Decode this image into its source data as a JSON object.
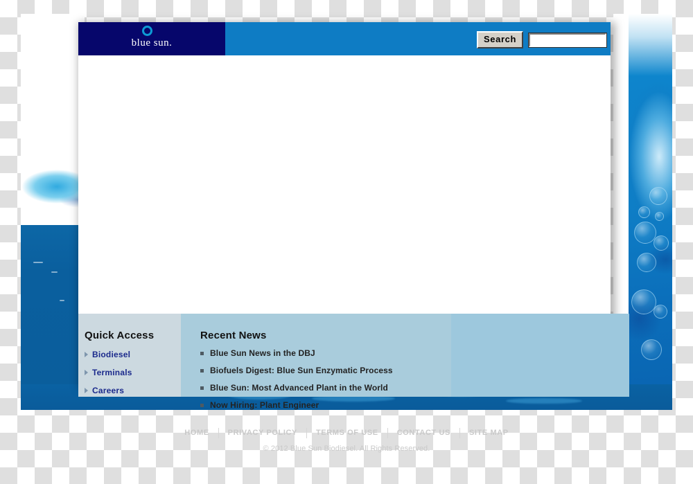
{
  "site": {
    "logo_text": "blue sun.",
    "logo_mark": "sun-ring-icon"
  },
  "search": {
    "button_label": "Search",
    "value": "",
    "placeholder": ""
  },
  "quick_access": {
    "title": "Quick Access",
    "items": [
      {
        "label": "Biodiesel"
      },
      {
        "label": "Terminals"
      },
      {
        "label": "Careers"
      }
    ]
  },
  "recent_news": {
    "title": "Recent News",
    "items": [
      {
        "label": "Blue Sun News in the DBJ"
      },
      {
        "label": "Biofuels Digest: Blue Sun Enzymatic Process"
      },
      {
        "label": "Blue Sun: Most Advanced Plant in the World"
      },
      {
        "label": "Now Hiring: Plant Engineer"
      }
    ]
  },
  "footer": {
    "links": [
      {
        "label": "HOME"
      },
      {
        "label": "PRIVACY POLICY"
      },
      {
        "label": "TERMS OF USE"
      },
      {
        "label": "CONTACT US"
      },
      {
        "label": "SITE MAP"
      }
    ],
    "copyright": "© 2012 Blue Sun Biodiesel. All Rights Reserved."
  },
  "colors": {
    "navy": "#06066b",
    "header_blue": "#0e7cc4",
    "sea_blue": "#0a5f9e",
    "ring_cyan": "#0d9ad4",
    "quick_access_bg": "#ccd9e0",
    "news_bg": "#a9ccdc",
    "extra_bg": "#9dc8dd",
    "link_blue": "#1b2a8c",
    "footer_text": "#c9c9c9"
  }
}
